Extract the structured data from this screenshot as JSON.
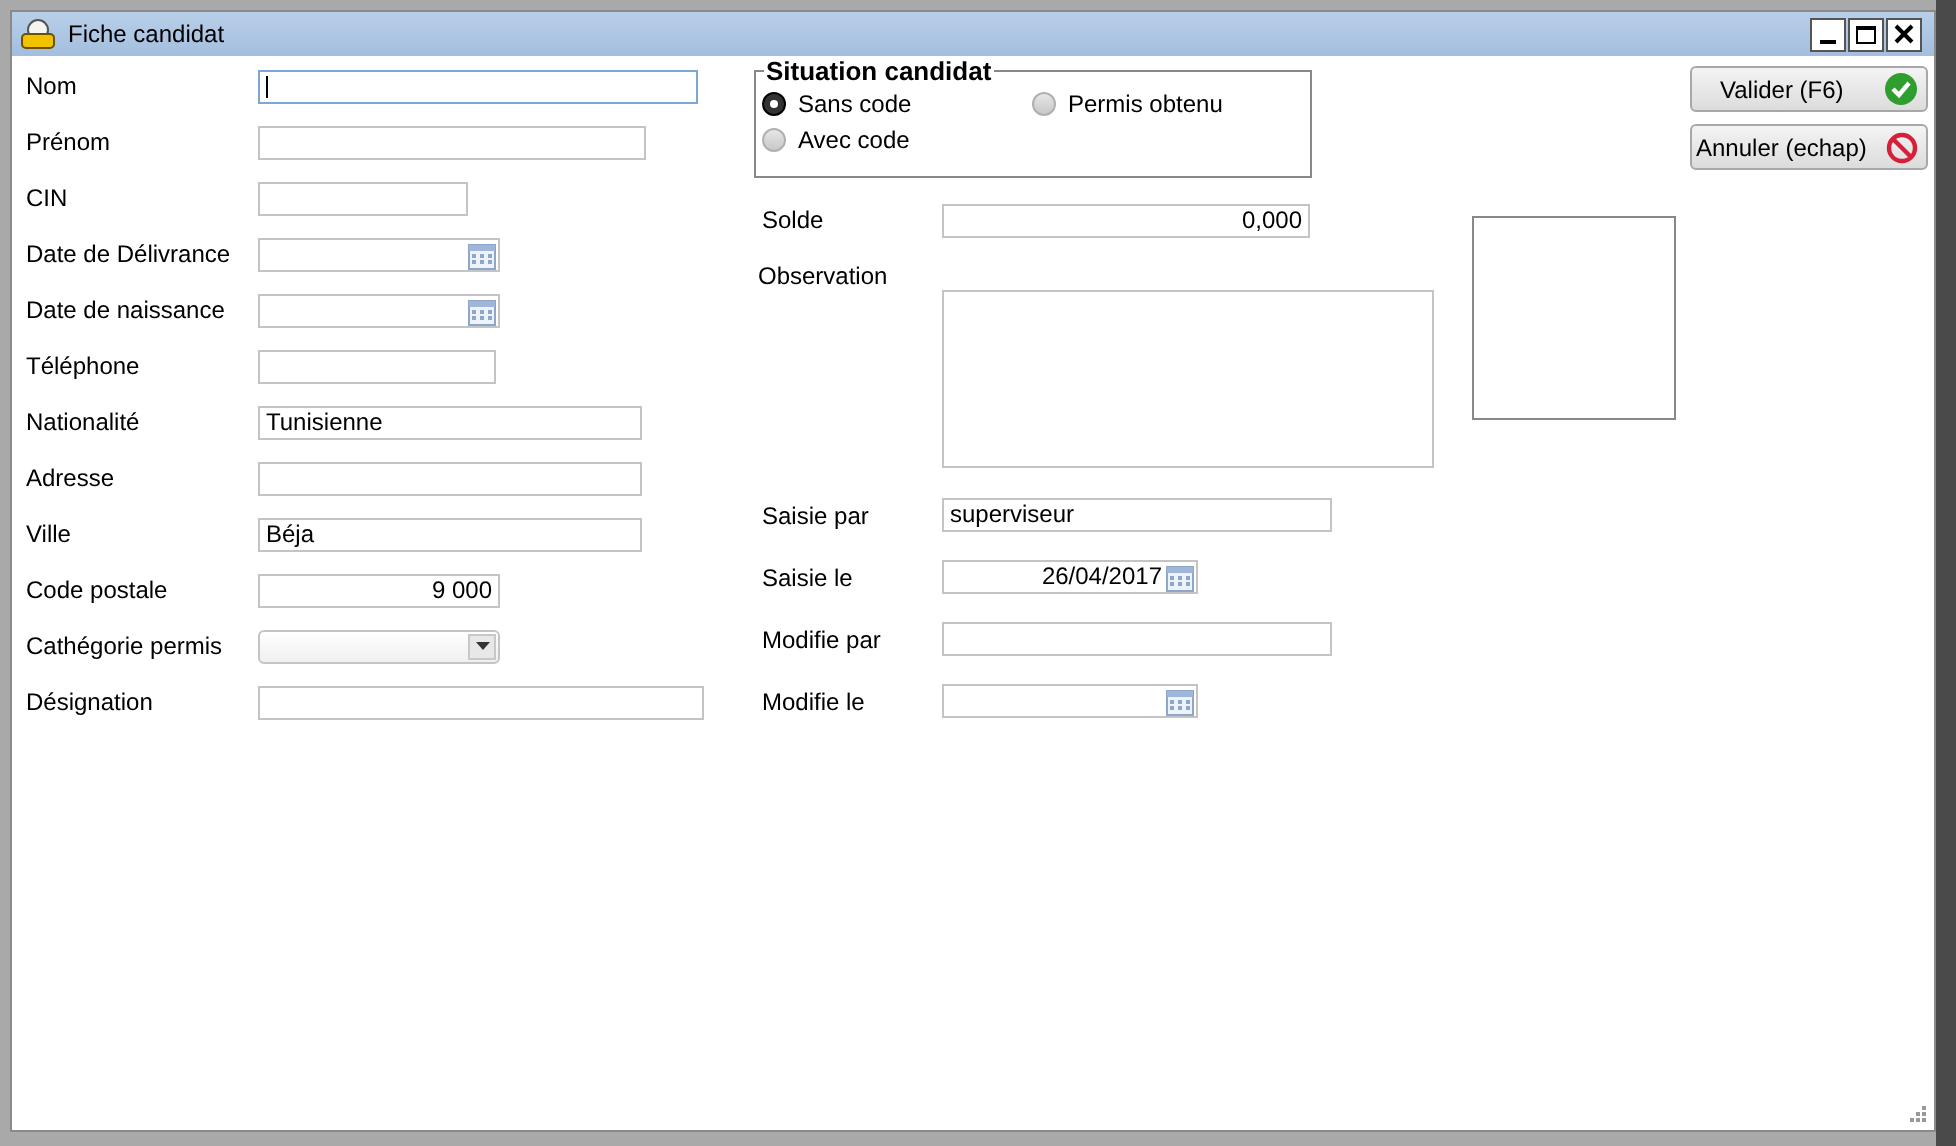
{
  "window": {
    "title": "Fiche candidat"
  },
  "fields": [
    {
      "label": "Nom",
      "kind": "text",
      "focused": true
    },
    {
      "label": "Prénom",
      "kind": "text",
      "focused": false
    },
    {
      "label": "CIN",
      "kind": "text",
      "focused": false
    },
    {
      "label": "Date de Délivrance",
      "kind": "date",
      "focused": false
    },
    {
      "label": "Date de naissance",
      "kind": "date",
      "focused": false
    },
    {
      "label": "Téléphone",
      "kind": "text",
      "focused": false
    },
    {
      "label": "Nationalité",
      "kind": "text",
      "value": "Tunisienne",
      "focused": false
    },
    {
      "label": "Adresse",
      "kind": "text",
      "focused": false
    },
    {
      "label": "Ville",
      "kind": "text",
      "value": "Béja",
      "focused": false
    },
    {
      "label": "Code postale",
      "kind": "number",
      "value": "9 000",
      "focused": false
    },
    {
      "label": "Cathégorie permis",
      "kind": "combo",
      "focused": false
    },
    {
      "label": "Désignation",
      "kind": "text",
      "focused": false
    }
  ],
  "situation": {
    "title": "Situation candidat",
    "options": [
      {
        "label": "Sans code",
        "selected": true
      },
      {
        "label": "Permis obtenu",
        "selected": false
      },
      {
        "label": "Avec code",
        "selected": false
      }
    ]
  },
  "details": [
    {
      "label": "Solde",
      "kind": "number",
      "value": "0,000"
    },
    {
      "label": "Observation",
      "kind": "memo"
    },
    {
      "label": "Saisie par",
      "kind": "text",
      "value": "superviseur"
    },
    {
      "label": "Saisie le",
      "kind": "date",
      "value": "26/04/2017"
    },
    {
      "label": "Modifie par",
      "kind": "text"
    },
    {
      "label": "Modifie le",
      "kind": "date"
    }
  ],
  "buttons": [
    {
      "label": "Valider (F6)",
      "kind": "validate"
    },
    {
      "label": "Annuler (echap)",
      "kind": "cancel"
    }
  ]
}
